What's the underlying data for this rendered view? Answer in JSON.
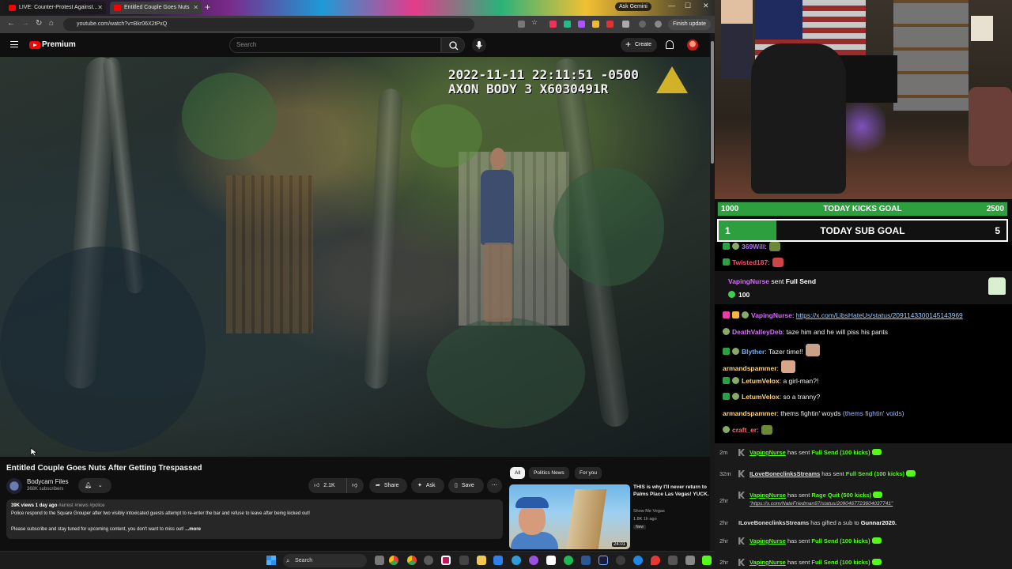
{
  "browser": {
    "tabs": [
      {
        "label": "LIVE: Counter-Protest Against...",
        "active": false
      },
      {
        "label": "Entitled Couple Goes Nuts",
        "active": true
      }
    ],
    "gemini_label": "Ask Gemini",
    "url": "youtube.com/watch?v=Bkr06X2tPxQ",
    "finish_update": "Finish update"
  },
  "youtube": {
    "logo_text": "Premium",
    "search_placeholder": "Search",
    "create_label": "Create",
    "video_overlay": {
      "timestamp": "2022-11-11 22:11:51 -0500",
      "device": "AXON BODY 3 X6030491R"
    },
    "video_title": "Entitled Couple Goes Nuts After Getting Trespassed",
    "channel": {
      "name": "Bodycam Files",
      "subs": "368K subscribers"
    },
    "actions": {
      "likes": "2.1K",
      "share": "Share",
      "ask": "Ask",
      "save": "Save"
    },
    "description": {
      "stats": "39K views  1 day ago",
      "tags": "#arrest #news #police",
      "line1": "Police respond to the Square Grouper after two visibly intoxicated guests attempt to re-enter the bar and refuse to leave after being kicked out!",
      "line2": "Please subscribe and stay tuned for upcoming content, you don't want to miss out!",
      "more": "...more"
    },
    "chips": [
      "All",
      "Politics News",
      "For you"
    ],
    "recommended": {
      "title": "THIS is why I'll never return to Palms Place Las Vegas! YUCK.",
      "channel": "Show Me Vegas",
      "meta": "1.8K  1h ago",
      "badge": "New",
      "duration": "24:01"
    }
  },
  "stream": {
    "kicks_goal": {
      "label": "TODAY KICKS GOAL",
      "current": "1000",
      "target": "2500",
      "fraction": 0.4
    },
    "sub_goal": {
      "label": "TODAY SUB GOAL",
      "current": "1",
      "target": "5",
      "fraction": 0.2
    },
    "chat": [
      {
        "user": "369Will",
        "color": "#b86cff",
        "text": ""
      },
      {
        "user": "Twisted187",
        "color": "#ff4d6d",
        "text": ""
      },
      {
        "user": "VapingNurse",
        "color": "#d86cff",
        "text": "https://x.com/LibsHateUs/status/2091143300145143969"
      },
      {
        "user": "DeathValleyDeb",
        "color": "#d86cff",
        "text": "taze him and he will piss his pants"
      },
      {
        "user": "Blyther",
        "color": "#6cb0ff",
        "text": "Tazer time!!"
      },
      {
        "user": "armandspammer",
        "color": "#ffd27a",
        "text": ""
      },
      {
        "user": "LetumVelox",
        "color": "#ffd27a",
        "text": "a girl-man?!"
      },
      {
        "user": "LetumVelox",
        "color": "#ffd27a",
        "text": "so a tranny?"
      },
      {
        "user": "armandspammer",
        "color": "#ffd27a",
        "text": "thems fightin' woyds",
        "extra": "(thems fightin' voids)"
      },
      {
        "user": "craft_er",
        "color": "#ff6b6b",
        "text": ""
      }
    ],
    "gift": {
      "user": "VapingNurse",
      "text": "sent",
      "item": "Full Send",
      "amount": "100"
    },
    "events": [
      {
        "time": "2m",
        "user": "VapingNurse",
        "action": "has sent",
        "item": "Full Send (100 kicks)"
      },
      {
        "time": "32m",
        "user": "ILoveBoneclinksStreams",
        "action": "has sent",
        "item": "Full Send (100 kicks)"
      },
      {
        "time": "2hr",
        "user": "VapingNurse",
        "action": "has sent",
        "item": "Rage Quit (500 kicks)",
        "note": "\"https://x.com/NateFriedman97/status/2090467723604037741\""
      },
      {
        "time": "2hr",
        "user": "ILoveBoneclinksStreams",
        "action": "has gifted a sub to",
        "item": "Gunnar2020."
      },
      {
        "time": "2hr",
        "user": "VapingNurse",
        "action": "has sent",
        "item": "Full Send (100 kicks)"
      },
      {
        "time": "2hr",
        "user": "VapingNurse",
        "action": "has sent",
        "item": "Full Send (100 kicks)"
      }
    ]
  },
  "taskbar": {
    "search_placeholder": "Search"
  }
}
